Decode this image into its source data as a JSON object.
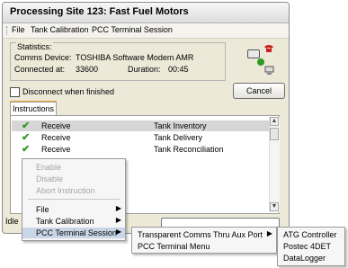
{
  "window": {
    "title": "Processing Site 123: Fast Fuel Motors"
  },
  "menu": {
    "items": [
      "File",
      "Tank Calibration",
      "PCC Terminal Session"
    ]
  },
  "statistics": {
    "legend": "Statistics:",
    "comms_device_label": "Comms Device:",
    "comms_device_value": "TOSHIBA Software Modem AMR",
    "connected_label": "Connected at:",
    "connected_value": "33600",
    "duration_label": "Duration:",
    "duration_value": "00:45"
  },
  "disconnect_label": "Disconnect when finished",
  "cancel_label": "Cancel",
  "tab_label": "Instructions",
  "instructions": [
    {
      "action": "Receive",
      "detail": "Tank Inventory"
    },
    {
      "action": "Receive",
      "detail": "Tank Delivery"
    },
    {
      "action": "Receive",
      "detail": "Tank Reconciliation"
    }
  ],
  "status_text": "Idle",
  "context_menu": {
    "disabled": [
      "Enable",
      "Disable",
      "Abort Instruction"
    ],
    "items": [
      "File",
      "Tank Calibration",
      "PCC Terminal Session"
    ]
  },
  "submenu_pcc": [
    "Transparent Comms Thru Aux Port",
    "PCC Terminal Menu"
  ],
  "submenu_ports": [
    "ATG Controller",
    "Postec 4DET",
    "DataLogger"
  ],
  "colors": {
    "check_green": "#2f9a21",
    "tab_accent": "#f2a33a",
    "highlight": "#c9d6e8"
  }
}
